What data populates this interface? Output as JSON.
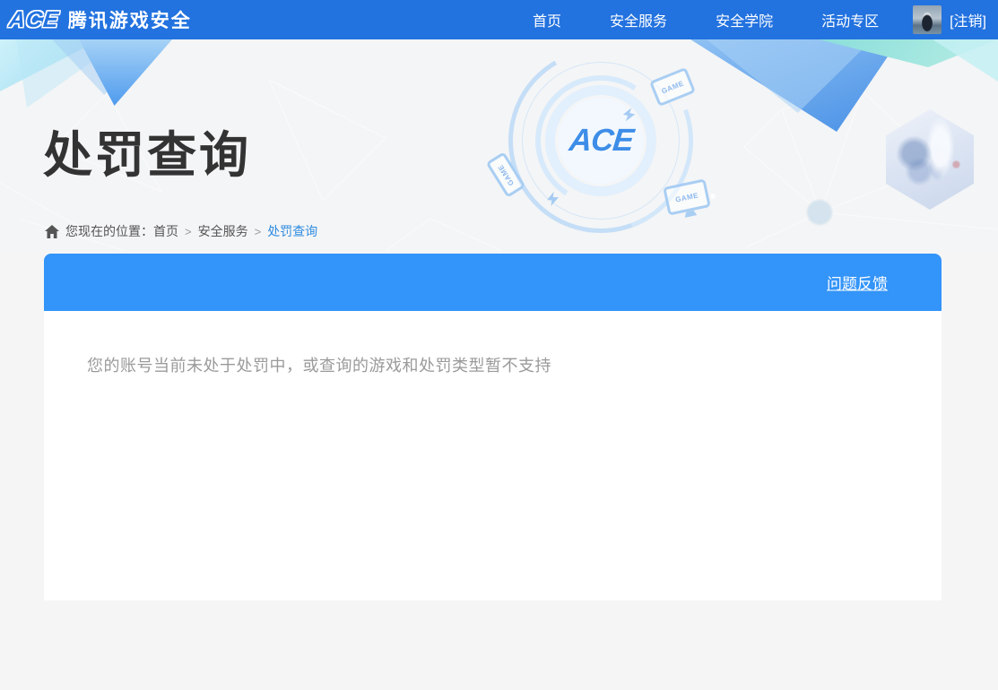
{
  "nav": {
    "logo_ace": "ACE",
    "logo_title": "腾讯游戏安全",
    "items": [
      {
        "label": "首页"
      },
      {
        "label": "安全服务"
      },
      {
        "label": "安全学院"
      },
      {
        "label": "活动专区"
      }
    ],
    "logout_label": "[注销]"
  },
  "hero": {
    "title": "处罚查询",
    "center_logo": "ACE",
    "game_label": "GAME"
  },
  "breadcrumb": {
    "prefix": "您现在的位置：",
    "separator": ">",
    "items": [
      {
        "label": "首页"
      },
      {
        "label": "安全服务"
      },
      {
        "label": "处罚查询"
      }
    ]
  },
  "feedback": {
    "link_label": "问题反馈"
  },
  "result": {
    "message": "您的账号当前未处于处罚中，或查询的游戏和处罚类型暂不支持"
  },
  "colors": {
    "nav_blue": "#2272df",
    "feedback_blue": "#3394f9",
    "breadcrumb_active_blue": "#2e8be0",
    "title_dark": "#333333",
    "message_gray": "#9a9a9a",
    "page_bg": "#f5f5f6"
  }
}
